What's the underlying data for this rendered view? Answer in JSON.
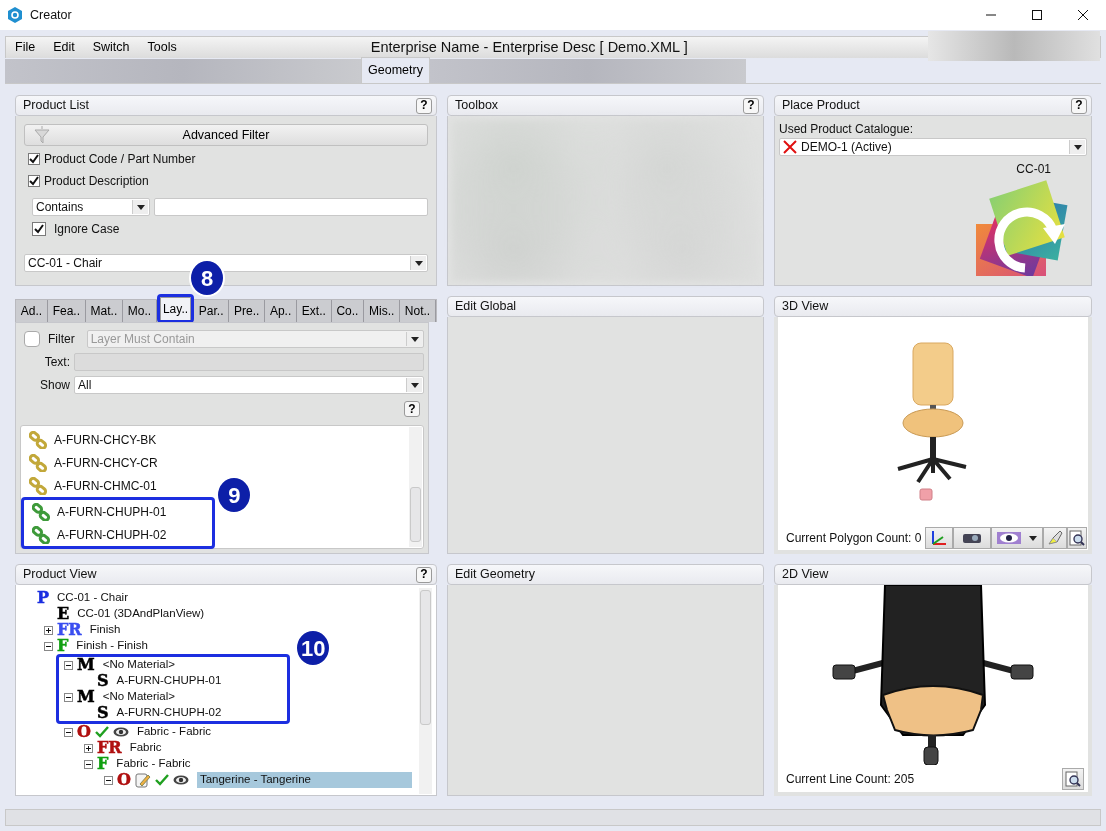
{
  "window": {
    "title": "Creator"
  },
  "menu": [
    "File",
    "Edit",
    "Switch",
    "Tools"
  ],
  "document_title": "Enterprise Name - Enterprise Desc [ Demo.XML ]",
  "tabs": [
    {
      "label": "Geometry",
      "selected": true
    }
  ],
  "product_list": {
    "title": "Product List",
    "help": "?",
    "advanced_filter": "Advanced Filter",
    "options": [
      {
        "label": "Product Code / Part Number",
        "checked": true
      },
      {
        "label": "Product Description",
        "checked": true
      }
    ],
    "match_mode": "Contains",
    "ignore_case": {
      "label": "Ignore Case",
      "checked": true
    },
    "product": "CC-01 - Chair"
  },
  "toolbox": {
    "title": "Toolbox",
    "help": "?"
  },
  "place_product": {
    "title": "Place Product",
    "help": "?",
    "catalogue_label": "Used Product Catalogue:",
    "catalogue": "DEMO-1 (Active)",
    "product_code": "CC-01"
  },
  "property_tabs": [
    {
      "label": "Ad..",
      "selected": false
    },
    {
      "label": "Fea..",
      "selected": false
    },
    {
      "label": "Mat..",
      "selected": false
    },
    {
      "label": "Mo..",
      "selected": false
    },
    {
      "label": "Lay..",
      "selected": true
    },
    {
      "label": "Par..",
      "selected": false
    },
    {
      "label": "Pre..",
      "selected": false
    },
    {
      "label": "Ap..",
      "selected": false
    },
    {
      "label": "Ext..",
      "selected": false
    },
    {
      "label": "Co..",
      "selected": false
    },
    {
      "label": "Mis..",
      "selected": false
    },
    {
      "label": "Not..",
      "selected": false
    }
  ],
  "layer_filter": {
    "filter": {
      "label": "Filter",
      "checked": false
    },
    "filter_mode": "Layer Must Contain",
    "text_label": "Text:",
    "show_label": "Show",
    "show": "All",
    "help": "?"
  },
  "layers": [
    {
      "name": "A-FURN-CHCY-BK",
      "color": "#c2a83a"
    },
    {
      "name": "A-FURN-CHCY-CR",
      "color": "#c2a83a"
    },
    {
      "name": "A-FURN-CHMC-01",
      "color": "#c2a83a"
    },
    {
      "name": "A-FURN-CHUPH-01",
      "color": "#3e9a3a"
    },
    {
      "name": "A-FURN-CHUPH-02",
      "color": "#3e9a3a"
    }
  ],
  "edit_global": {
    "title": "Edit Global"
  },
  "view_3d": {
    "title": "3D View",
    "status": "Current Polygon Count: 0"
  },
  "product_view": {
    "title": "Product View",
    "help": "?",
    "tree": [
      {
        "letter": "P",
        "color": "#1a2ee0",
        "label": "CC-01 - Chair",
        "selected": false,
        "children": [
          {
            "letter": "E",
            "color": "#000000",
            "label": "CC-01 (3DAndPlanView)",
            "selected": false
          },
          {
            "letter": "FR",
            "color": "#3a4ef0",
            "label": "Finish",
            "expanded": false,
            "selected": false
          },
          {
            "letter": "F",
            "color": "#10a010",
            "label": "Finish - Finish",
            "expanded": true,
            "selected": false,
            "children": [
              {
                "letter": "M",
                "color": "#000000",
                "label": "<No Material>",
                "expanded": true,
                "selected": false,
                "children": [
                  {
                    "letter": "S",
                    "color": "#000000",
                    "label": "A-FURN-CHUPH-01",
                    "selected": false
                  }
                ]
              },
              {
                "letter": "M",
                "color": "#000000",
                "label": "<No Material>",
                "expanded": true,
                "selected": false,
                "children": [
                  {
                    "letter": "S",
                    "color": "#000000",
                    "label": "A-FURN-CHUPH-02",
                    "selected": false
                  }
                ]
              },
              {
                "letter": "O",
                "color": "#b01010",
                "label": "Fabric - Fabric",
                "expanded": true,
                "edited": false,
                "checked": true,
                "visible": true,
                "selected": false,
                "children": [
                  {
                    "letter": "FR",
                    "color": "#b01010",
                    "label": "Fabric",
                    "expanded": false,
                    "selected": false
                  },
                  {
                    "letter": "F",
                    "color": "#10a010",
                    "label": "Fabric - Fabric",
                    "expanded": true,
                    "selected": false,
                    "children": [
                      {
                        "letter": "O",
                        "color": "#b01010",
                        "label": "Tangerine - Tangerine",
                        "expanded": true,
                        "edited": true,
                        "checked": true,
                        "visible": true,
                        "selected": true
                      }
                    ]
                  }
                ]
              }
            ]
          }
        ]
      }
    ]
  },
  "edit_geometry": {
    "title": "Edit Geometry"
  },
  "view_2d": {
    "title": "2D View",
    "status": "Current Line Count: 205"
  },
  "callouts": [
    {
      "label": "8"
    },
    {
      "label": "9"
    },
    {
      "label": "10"
    }
  ]
}
